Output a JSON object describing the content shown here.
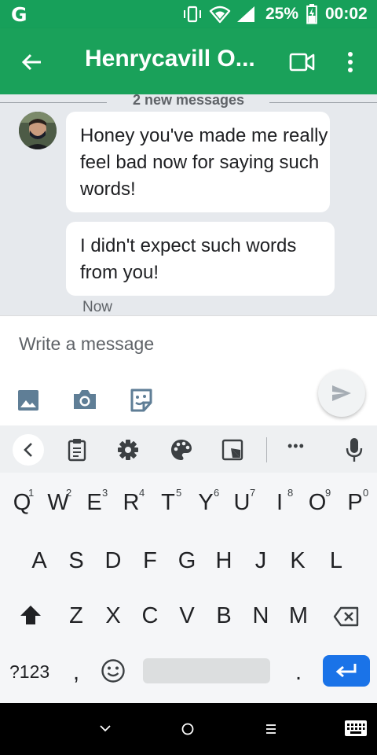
{
  "status_bar": {
    "app_glyph": "G",
    "battery_percent": "25%",
    "time": "00:02",
    "icons": [
      "vibrate-icon",
      "wifi-icon",
      "signal-icon",
      "battery-icon"
    ]
  },
  "app_bar": {
    "title": "Henrycavill O...",
    "icons": [
      "back-arrow-icon",
      "video-call-icon",
      "more-vert-icon"
    ]
  },
  "conversation": {
    "divider_label": "2 new messages",
    "messages": [
      {
        "text": "Honey you've made me really feel bad now for saying such words!"
      },
      {
        "text": "I didn't expect such words from you!"
      }
    ],
    "timestamp": "Now"
  },
  "composer": {
    "placeholder": "Write a message",
    "icons": [
      "gallery-icon",
      "camera-icon",
      "sticker-icon",
      "send-icon"
    ]
  },
  "keyboard_toolbar": {
    "icons": [
      "chevron-left-icon",
      "clipboard-icon",
      "settings-icon",
      "palette-icon",
      "resize-icon",
      "more-icon",
      "mic-icon"
    ],
    "more_label": "•••"
  },
  "keyboard": {
    "row1": [
      {
        "key": "Q",
        "hint": "1"
      },
      {
        "key": "W",
        "hint": "2"
      },
      {
        "key": "E",
        "hint": "3"
      },
      {
        "key": "R",
        "hint": "4"
      },
      {
        "key": "T",
        "hint": "5"
      },
      {
        "key": "Y",
        "hint": "6"
      },
      {
        "key": "U",
        "hint": "7"
      },
      {
        "key": "I",
        "hint": "8"
      },
      {
        "key": "O",
        "hint": "9"
      },
      {
        "key": "P",
        "hint": "0"
      }
    ],
    "row2": [
      "A",
      "S",
      "D",
      "F",
      "G",
      "H",
      "J",
      "K",
      "L"
    ],
    "row3": [
      "Z",
      "X",
      "C",
      "V",
      "B",
      "N",
      "M"
    ],
    "symbols_key": "?123",
    "comma_key": ",",
    "period_key": "."
  },
  "nav_bar": {
    "icons": [
      "nav-down-icon",
      "home-icon",
      "menu-icon",
      "keyboard-switch-icon"
    ]
  }
}
